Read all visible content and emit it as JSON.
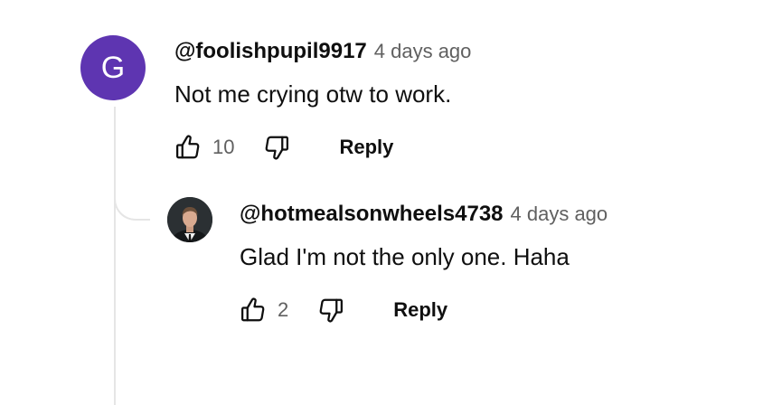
{
  "comments": [
    {
      "avatar_letter": "G",
      "handle": "@foolishpupil9917",
      "time": "4 days ago",
      "text": "Not me crying otw to work.",
      "likes": "10",
      "reply_label": "Reply",
      "avatar_color": "#5e35b1"
    },
    {
      "handle": "@hotmealsonwheels4738",
      "time": "4 days ago",
      "text": "Glad I'm not the only one. Haha",
      "likes": "2",
      "reply_label": "Reply"
    }
  ],
  "icons": {
    "like": "thumbs-up-outline",
    "dislike": "thumbs-down-outline"
  },
  "colors": {
    "primary_text": "#0f0f0f",
    "secondary_text": "#606060",
    "thread_line": "#e5e5e5"
  }
}
